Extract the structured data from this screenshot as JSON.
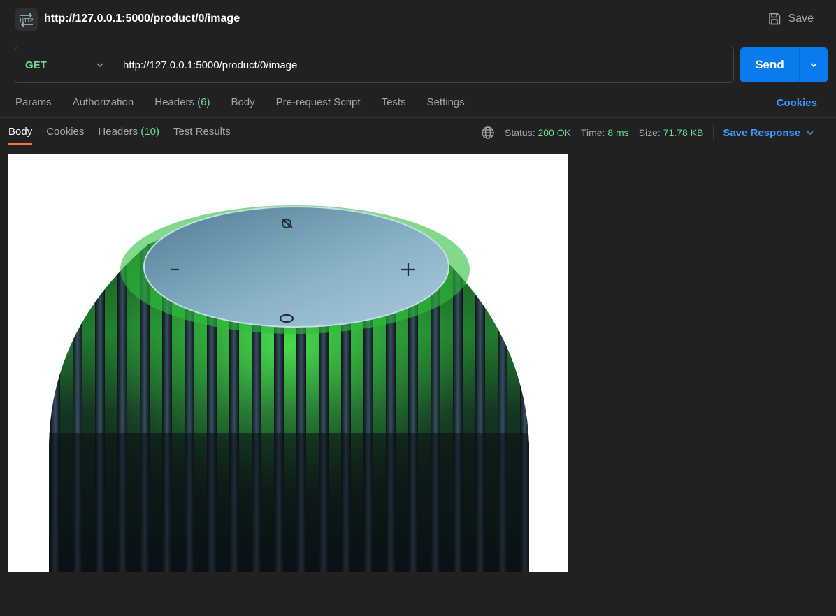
{
  "header": {
    "title": "http://127.0.0.1:5000/product/0/image",
    "icon": "http-icon",
    "save_label": "Save"
  },
  "request": {
    "method": "GET",
    "url": "http://127.0.0.1:5000/product/0/image",
    "send_label": "Send"
  },
  "request_tabs": {
    "params": "Params",
    "authorization": "Authorization",
    "headers": "Headers",
    "headers_count": "(6)",
    "body": "Body",
    "prerequest": "Pre-request Script",
    "tests": "Tests",
    "settings": "Settings",
    "cookies_link": "Cookies"
  },
  "response_tabs": {
    "body": "Body",
    "cookies": "Cookies",
    "headers": "Headers",
    "headers_count": "(10)",
    "test_results": "Test Results"
  },
  "response_meta": {
    "status_label": "Status:",
    "status_value": "200 OK",
    "time_label": "Time:",
    "time_value": "8 ms",
    "size_label": "Size:",
    "size_value": "71.78 KB",
    "save_response": "Save Response"
  },
  "colors": {
    "background": "#212121",
    "accent_blue": "#097bed",
    "link_blue": "#3d9bff",
    "success_green": "#6bdd9a",
    "active_tab_underline": "#ff6c37"
  }
}
